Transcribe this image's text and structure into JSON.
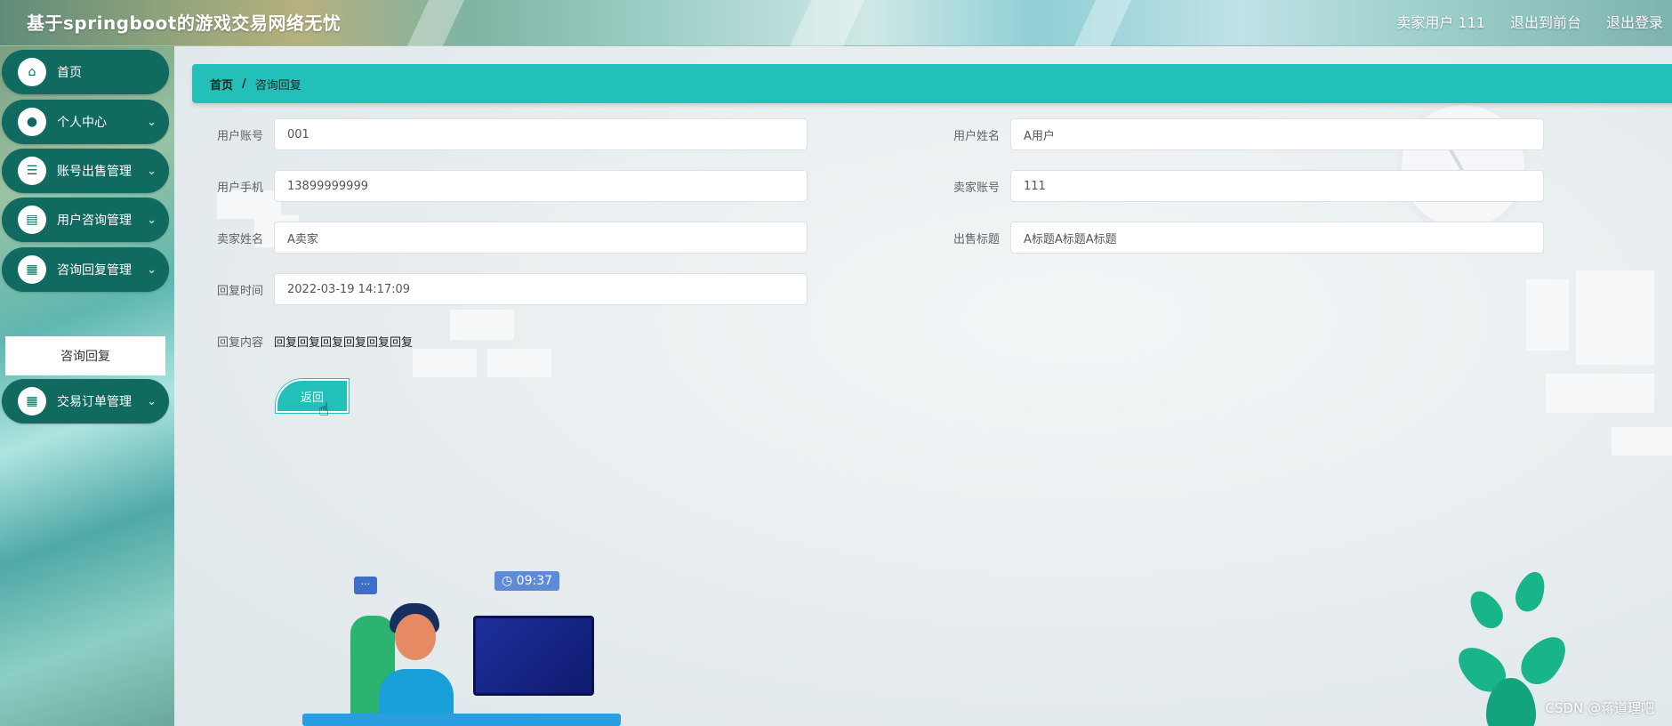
{
  "header": {
    "title": "基于springboot的游戏交易网络无忧",
    "user_label": "卖家用户 111",
    "exit_front": "退出到前台",
    "logout": "退出登录"
  },
  "sidebar": {
    "items": [
      {
        "label": "首页",
        "icon": "home-icon"
      },
      {
        "label": "个人中心",
        "icon": "user-icon"
      },
      {
        "label": "账号出售管理",
        "icon": "list-icon"
      },
      {
        "label": "用户咨询管理",
        "icon": "clipboard-icon"
      },
      {
        "label": "咨询回复管理",
        "icon": "grid-icon"
      },
      {
        "label": "交易订单管理",
        "icon": "grid-icon"
      }
    ],
    "sub_item": "咨询回复"
  },
  "breadcrumb": {
    "home": "首页",
    "separator": "/",
    "current": "咨询回复"
  },
  "form": {
    "user_account_label": "用户账号",
    "user_account": "001",
    "user_name_label": "用户姓名",
    "user_name": "A用户",
    "user_phone_label": "用户手机",
    "user_phone": "13899999999",
    "seller_account_label": "卖家账号",
    "seller_account": "111",
    "seller_name_label": "卖家姓名",
    "seller_name": "A卖家",
    "sale_title_label": "出售标题",
    "sale_title": "A标题A标题A标题",
    "reply_time_label": "回复时间",
    "reply_time": "2022-03-19 14:17:09",
    "reply_content_label": "回复内容",
    "reply_content": "回复回复回复回复回复回复"
  },
  "back_button": "返回",
  "illustration": {
    "time": "09:37",
    "chat": "···"
  },
  "watermark": "CSDN @蒋道理吧",
  "colors": {
    "accent": "#22c0b8",
    "sidebar_item": "#106a60"
  }
}
